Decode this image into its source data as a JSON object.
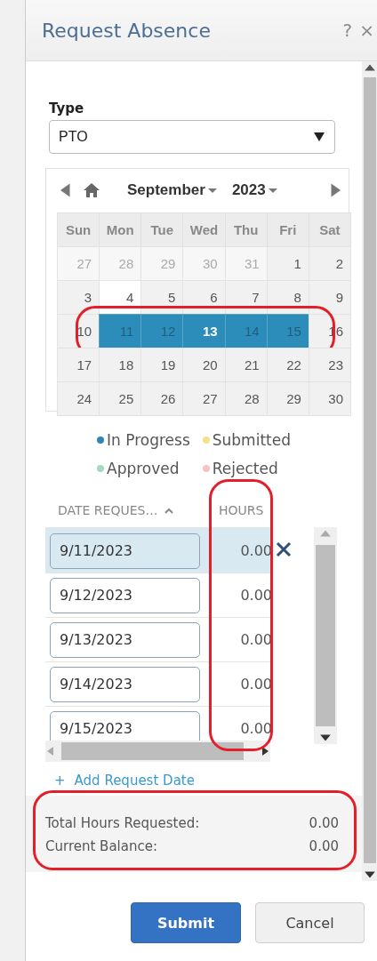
{
  "window": {
    "title": "Request Absence",
    "help": "?",
    "close": "×"
  },
  "type_field": {
    "label": "Type",
    "value": "PTO"
  },
  "calendar": {
    "month": "September",
    "year": "2023",
    "weekdays": [
      "Sun",
      "Mon",
      "Tue",
      "Wed",
      "Thu",
      "Fri",
      "Sat"
    ],
    "weeks": [
      {
        "circled": false,
        "days": [
          {
            "label": "27",
            "outside": true,
            "today": false,
            "selected": false,
            "focused": false
          },
          {
            "label": "28",
            "outside": true,
            "today": false,
            "selected": false,
            "focused": false
          },
          {
            "label": "29",
            "outside": true,
            "today": false,
            "selected": false,
            "focused": false
          },
          {
            "label": "30",
            "outside": true,
            "today": false,
            "selected": false,
            "focused": false
          },
          {
            "label": "31",
            "outside": true,
            "today": false,
            "selected": false,
            "focused": false
          },
          {
            "label": "1",
            "outside": false,
            "today": false,
            "selected": false,
            "focused": false
          },
          {
            "label": "2",
            "outside": false,
            "today": false,
            "selected": false,
            "focused": false
          }
        ]
      },
      {
        "circled": false,
        "days": [
          {
            "label": "3",
            "outside": false,
            "today": false,
            "selected": false,
            "focused": false
          },
          {
            "label": "4",
            "outside": false,
            "today": true,
            "selected": false,
            "focused": false
          },
          {
            "label": "5",
            "outside": false,
            "today": false,
            "selected": false,
            "focused": false
          },
          {
            "label": "6",
            "outside": false,
            "today": false,
            "selected": false,
            "focused": false
          },
          {
            "label": "7",
            "outside": false,
            "today": false,
            "selected": false,
            "focused": false
          },
          {
            "label": "8",
            "outside": false,
            "today": false,
            "selected": false,
            "focused": false
          },
          {
            "label": "9",
            "outside": false,
            "today": false,
            "selected": false,
            "focused": false
          }
        ]
      },
      {
        "circled": true,
        "days": [
          {
            "label": "10",
            "outside": false,
            "today": false,
            "selected": false,
            "focused": false
          },
          {
            "label": "11",
            "outside": false,
            "today": false,
            "selected": true,
            "focused": false
          },
          {
            "label": "12",
            "outside": false,
            "today": false,
            "selected": true,
            "focused": false
          },
          {
            "label": "13",
            "outside": false,
            "today": false,
            "selected": true,
            "focused": true
          },
          {
            "label": "14",
            "outside": false,
            "today": false,
            "selected": true,
            "focused": false
          },
          {
            "label": "15",
            "outside": false,
            "today": false,
            "selected": true,
            "focused": false
          },
          {
            "label": "16",
            "outside": false,
            "today": false,
            "selected": false,
            "focused": false
          }
        ]
      },
      {
        "circled": false,
        "days": [
          {
            "label": "17",
            "outside": false,
            "today": false,
            "selected": false,
            "focused": false
          },
          {
            "label": "18",
            "outside": false,
            "today": false,
            "selected": false,
            "focused": false
          },
          {
            "label": "19",
            "outside": false,
            "today": false,
            "selected": false,
            "focused": false
          },
          {
            "label": "20",
            "outside": false,
            "today": false,
            "selected": false,
            "focused": false
          },
          {
            "label": "21",
            "outside": false,
            "today": false,
            "selected": false,
            "focused": false
          },
          {
            "label": "22",
            "outside": false,
            "today": false,
            "selected": false,
            "focused": false
          },
          {
            "label": "23",
            "outside": false,
            "today": false,
            "selected": false,
            "focused": false
          }
        ]
      },
      {
        "circled": false,
        "days": [
          {
            "label": "24",
            "outside": false,
            "today": false,
            "selected": false,
            "focused": false
          },
          {
            "label": "25",
            "outside": false,
            "today": false,
            "selected": false,
            "focused": false
          },
          {
            "label": "26",
            "outside": false,
            "today": false,
            "selected": false,
            "focused": false
          },
          {
            "label": "27",
            "outside": false,
            "today": false,
            "selected": false,
            "focused": false
          },
          {
            "label": "28",
            "outside": false,
            "today": false,
            "selected": false,
            "focused": false
          },
          {
            "label": "29",
            "outside": false,
            "today": false,
            "selected": false,
            "focused": false
          },
          {
            "label": "30",
            "outside": false,
            "today": false,
            "selected": false,
            "focused": false
          }
        ]
      }
    ]
  },
  "legend": [
    {
      "label": "In Progress",
      "color": "#2e86b8"
    },
    {
      "label": "Submitted",
      "color": "#f7e08a"
    },
    {
      "label": "Approved",
      "color": "#a3dcbc"
    },
    {
      "label": "Rejected",
      "color": "#f6c4c4"
    }
  ],
  "table": {
    "columns": [
      {
        "label": "DATE REQUES…",
        "sorted_ascending": true
      },
      {
        "label": "HOURS",
        "sorted_ascending": false
      }
    ],
    "hours_circled": true,
    "rows": [
      {
        "date": "9/11/2023",
        "hours": "0.00",
        "selected": true
      },
      {
        "date": "9/12/2023",
        "hours": "0.00",
        "selected": false
      },
      {
        "date": "9/13/2023",
        "hours": "0.00",
        "selected": false
      },
      {
        "date": "9/14/2023",
        "hours": "0.00",
        "selected": false
      },
      {
        "date": "9/15/2023",
        "hours": "0.00",
        "selected": false
      }
    ]
  },
  "add_link": {
    "icon": "+",
    "label": "Add Request Date"
  },
  "summary": {
    "circled": true,
    "lines": [
      {
        "label": "Total Hours Requested:",
        "value": "0.00"
      },
      {
        "label": "Current Balance:",
        "value": "0.00"
      }
    ]
  },
  "buttons": [
    {
      "label": "Submit",
      "kind": "primary"
    },
    {
      "label": "Cancel",
      "kind": "secondary"
    }
  ]
}
